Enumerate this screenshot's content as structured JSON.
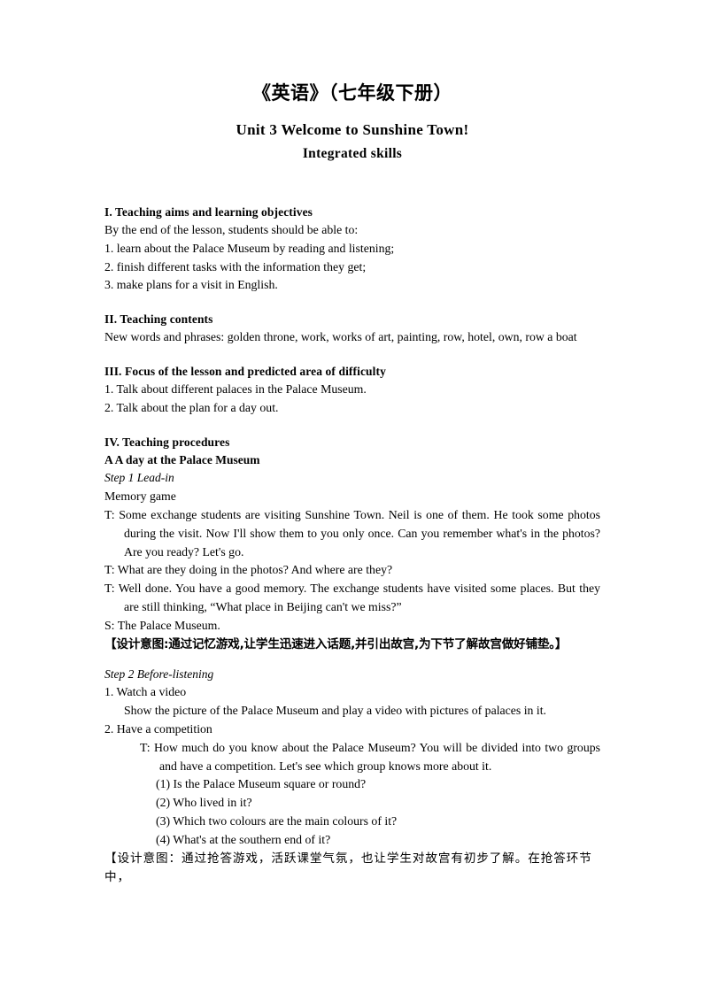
{
  "document": {
    "title_cn": "《英语》（七年级下册）",
    "title_unit": "Unit 3 Welcome to Sunshine Town!",
    "title_sub": "Integrated skills"
  },
  "sections": {
    "aims": {
      "heading": "I. Teaching aims and learning objectives",
      "intro": "By the end of the lesson, students should be able to:",
      "item1": "1. learn about the Palace Museum by reading and listening;",
      "item2": "2. finish different tasks with the information they get;",
      "item3": "3. make plans for a visit in English."
    },
    "contents": {
      "heading": "II. Teaching contents",
      "words": "New words and phrases: golden throne, work, works of art, painting, row, hotel, own, row a boat"
    },
    "focus": {
      "heading": "III. Focus of the lesson and predicted area of difficulty",
      "item1": "1. Talk about different palaces in the Palace Museum.",
      "item2": "2. Talk about the plan for a day out."
    },
    "procedures": {
      "heading": "IV. Teaching procedures",
      "part_a": "A\tA day at the Palace Museum",
      "step1": {
        "label": "Step 1 Lead-in",
        "activity": "Memory game",
        "t1": "T: Some exchange students are visiting Sunshine Town. Neil is one of them. He took some photos during the visit. Now I'll show them to you only once. Can you remember what's in the photos? Are you ready? Let's go.",
        "t2": "T: What are they doing in the photos? And where are they?",
        "t3": "T: Well done. You have a good memory. The exchange students have visited some places. But they are still thinking, “What place in Beijing can't we miss?”",
        "s1": "S: The Palace Museum.",
        "note_cn": "【设计意图:通过记忆游戏,让学生迅速进入话题,并引出故宫,为下节了解故宫做好铺垫。】"
      },
      "step2": {
        "label": "Step 2 Before-listening",
        "item1": "1. Watch a video",
        "item1_body": "Show the picture of the Palace Museum and play a video with pictures of palaces in it.",
        "item2": "2. Have a competition",
        "item2_t": "T: How much do you know about the Palace Museum? You will be divided into two groups and have a competition. Let's see which group knows more about it.",
        "q1": "(1) Is the Palace Museum square or round?",
        "q2": "(2) Who lived in it?",
        "q3": "(3) Which two colours are the main colours of it?",
        "q4": "(4) What's at the southern end of it?",
        "note_cn": "【设计意图：通过抢答游戏，活跃课堂气氛，也让学生对故宫有初步了解。在抢答环节中，"
      }
    }
  }
}
